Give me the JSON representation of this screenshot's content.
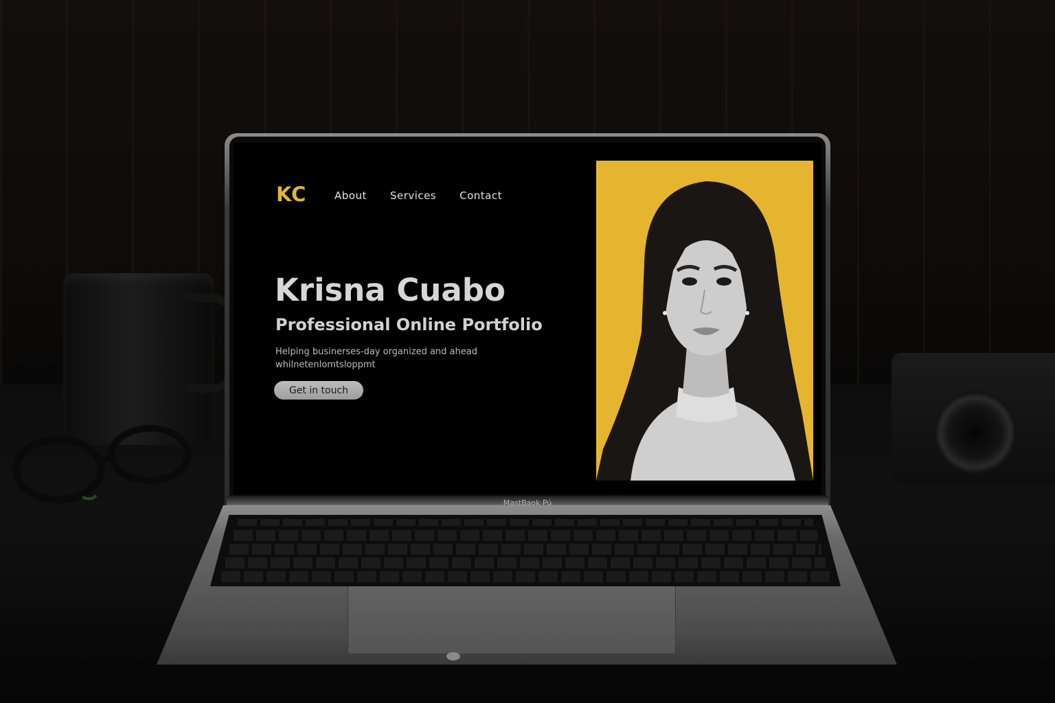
{
  "site": {
    "logo": "KC",
    "nav": [
      {
        "label": "About"
      },
      {
        "label": "Services"
      },
      {
        "label": "Contact"
      }
    ],
    "hero": {
      "name": "Krisna Cuabo",
      "subtitle": "Professional Online Portfolio",
      "description_lines": [
        "Helping businerses-day organized and ahead",
        "whilnetenlomtsloppmt"
      ],
      "cta_label": "Get in touch"
    },
    "portrait": {
      "alt": "Portrait photo",
      "background_color": "#e5b52f"
    }
  },
  "device": {
    "model_label": "MastBaok Pú"
  },
  "colors": {
    "accent": "#e0b637",
    "screen_background": "#000000",
    "text_primary": "#d6d6d6",
    "button_background": "#b0b0b0"
  },
  "icons": {
    "logo": "kc-monogram"
  }
}
